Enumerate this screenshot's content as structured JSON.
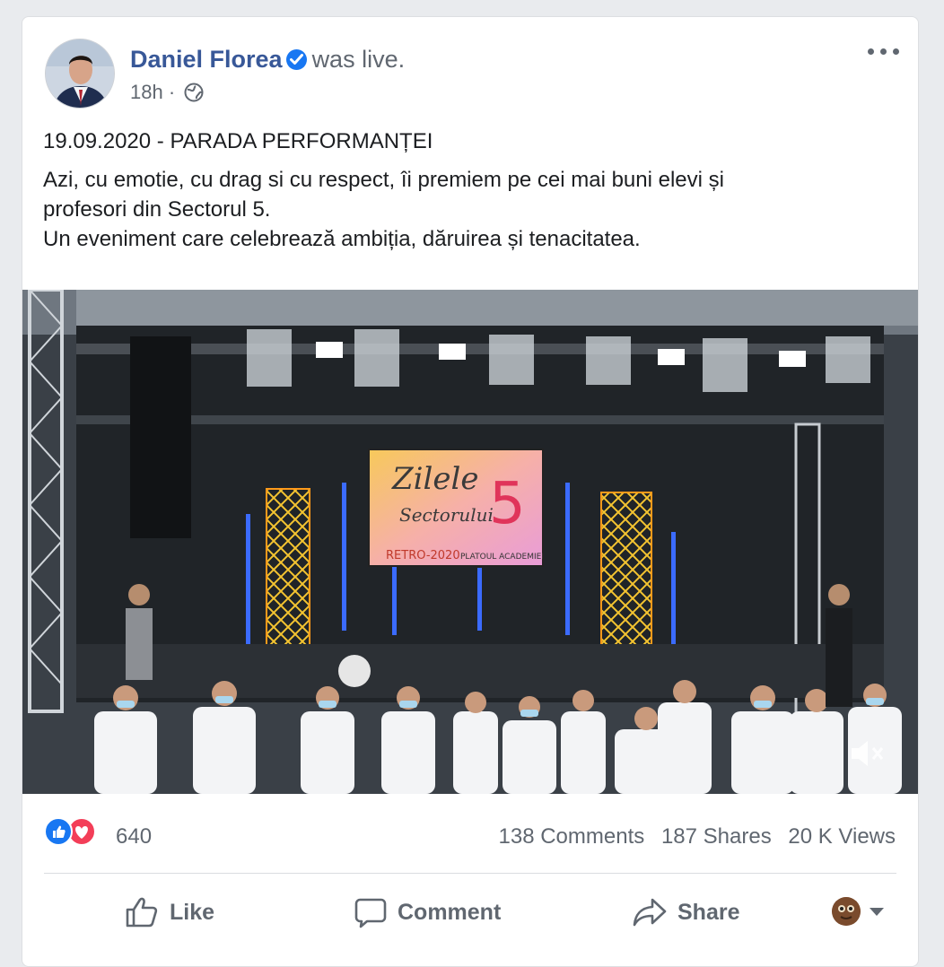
{
  "post": {
    "author": "Daniel Florea",
    "status": "was live.",
    "time": "18h",
    "separator": "·",
    "audience_icon": "globe-icon",
    "more_icon": "more-horizontal-icon",
    "verified_icon": "verified-badge-icon",
    "title": "19.09.2020 - PARADA PERFORMANȚEI",
    "body_lines": [
      "Azi, cu emotie, cu drag si cu respect, îi premiem pe cei mai buni elevi și",
      "profesori din Sectorul 5.",
      "Un eveniment care celebrează ambiția, dăruirea și tenacitatea."
    ]
  },
  "video": {
    "screen_text_1": "Zilele",
    "screen_text_2": "Sectorului",
    "screen_number": "5",
    "screen_text_3": "RETRO-2020",
    "screen_text_4": "PLATOUL ACADEMIEI",
    "mute_icon": "muted-speaker-icon"
  },
  "stats": {
    "reaction_count": "640",
    "comments": "138 Comments",
    "shares": "187 Shares",
    "views": "20 K Views"
  },
  "actions": {
    "like": "Like",
    "comment": "Comment",
    "share": "Share"
  },
  "colors": {
    "link_blue": "#385898",
    "like_blue": "#1877f2",
    "love_red": "#f33e58",
    "meta_gray": "#606770"
  }
}
